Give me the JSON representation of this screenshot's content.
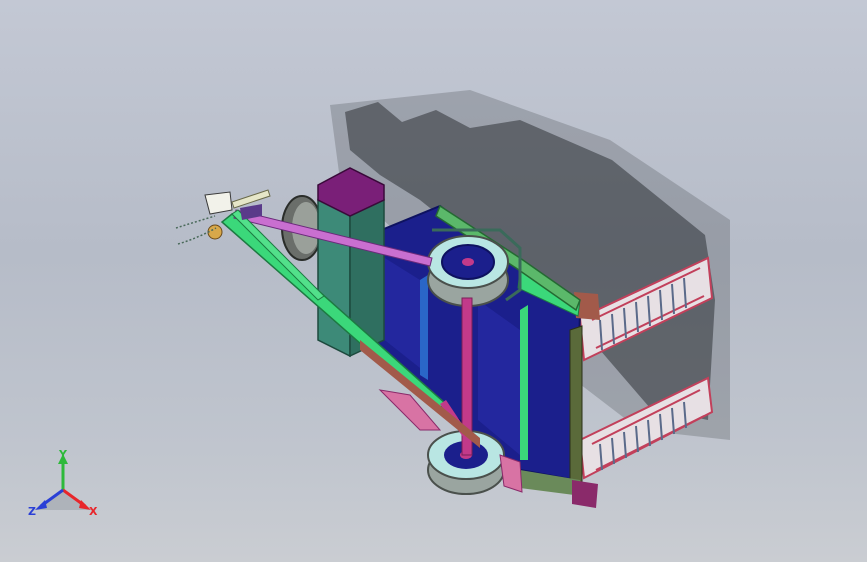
{
  "triad": {
    "x_label": "X",
    "y_label": "Y",
    "z_label": "Z",
    "x_color": "#e8262b",
    "y_color": "#2db93a",
    "z_color": "#2a3fd6"
  },
  "model": {
    "deck_color": "#1b1f8c",
    "frame_color": "#3bd87a",
    "rail_color": "#e0567a",
    "tire_color": "#b9e6e3",
    "box_color": "#7a1f78"
  }
}
